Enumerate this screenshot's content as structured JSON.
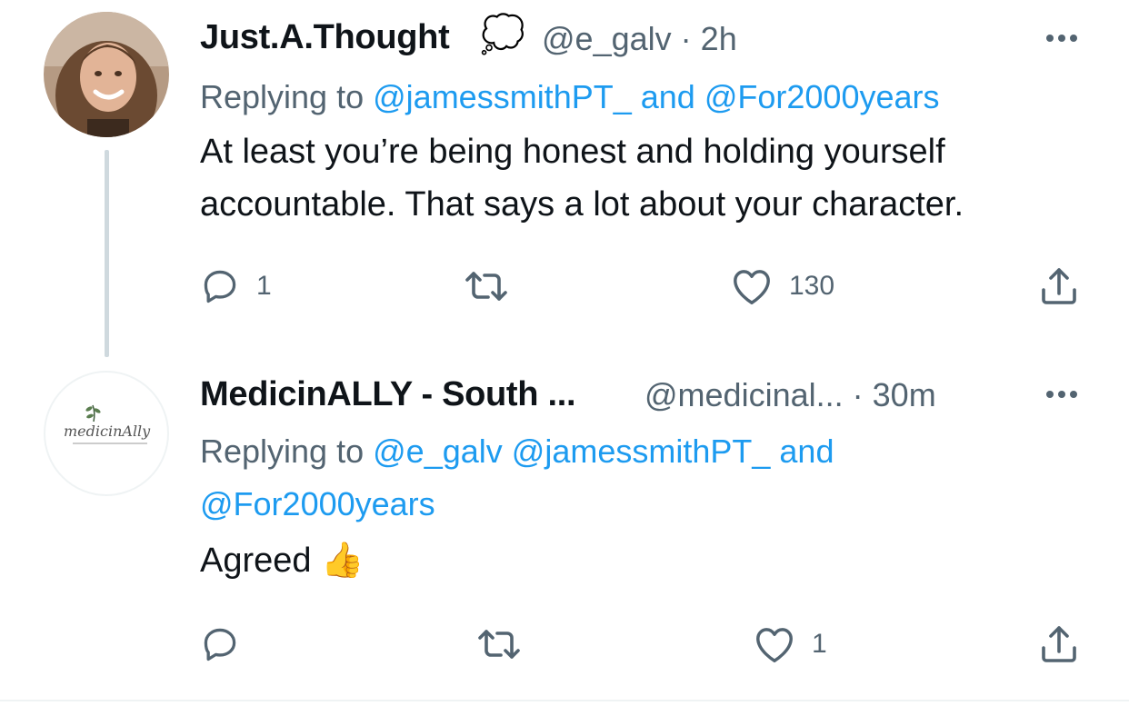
{
  "tweets": [
    {
      "display_name": "Just.A.Thought",
      "name_emoji": "💭",
      "handle": "@e_galv",
      "separator": "·",
      "time": "2h",
      "replying_prefix": "Replying to",
      "reply_line1": {
        "m1": "@jamessmithPT_",
        "and": "and",
        "m2": "@For2000years"
      },
      "text_lines": [
        "At least you’re being honest and holding yourself",
        "accountable. That says a lot about your character."
      ],
      "actions": {
        "reply_count": "1",
        "retweet_count": "",
        "like_count": "130"
      }
    },
    {
      "display_name": "MedicinALLY - South ...",
      "handle": "@medicinal...",
      "separator": "·",
      "time": "30m",
      "avatar_logo_text": "medicinAlly",
      "replying_prefix": "Replying to",
      "reply_line1": {
        "m1": "@e_galv",
        "m2": "@jamessmithPT_",
        "and": "and"
      },
      "reply_line2": {
        "m3": "@For2000years"
      },
      "text": "Agreed",
      "text_emoji": "👍",
      "actions": {
        "reply_count": "",
        "retweet_count": "",
        "like_count": "1"
      }
    }
  ],
  "colors": {
    "accent": "#1d9bf0",
    "secondary_text": "#536471",
    "thread_line": "#cfd9de"
  }
}
